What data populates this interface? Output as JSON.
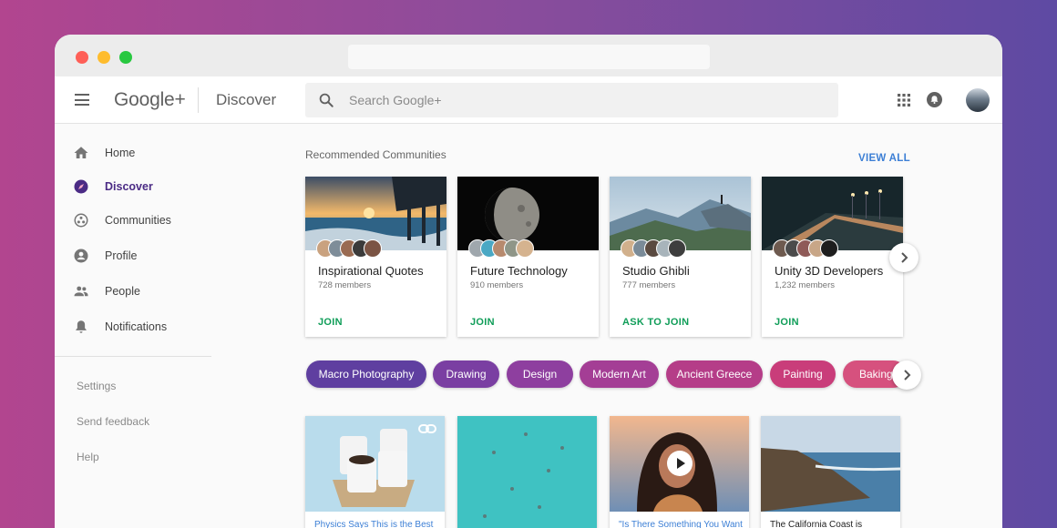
{
  "app": {
    "logo": "Google+",
    "section": "Discover"
  },
  "search": {
    "placeholder": "Search Google+",
    "value": ""
  },
  "sidebar": {
    "items": [
      {
        "label": "Home",
        "icon": "home-icon"
      },
      {
        "label": "Discover",
        "icon": "compass-icon",
        "active": true
      },
      {
        "label": "Communities",
        "icon": "communities-icon"
      },
      {
        "label": "Profile",
        "icon": "profile-icon"
      },
      {
        "label": "People",
        "icon": "people-icon"
      },
      {
        "label": "Notifications",
        "icon": "bell-icon"
      }
    ],
    "links": [
      "Settings",
      "Send feedback",
      "Help"
    ]
  },
  "recommended": {
    "title": "Recommended Communities",
    "view_all": "VIEW ALL",
    "cards": [
      {
        "name": "Inspirational Quotes",
        "members": "728 members",
        "action": "JOIN"
      },
      {
        "name": "Future Technology",
        "members": "910 members",
        "action": "JOIN"
      },
      {
        "name": "Studio Ghibli",
        "members": "777 members",
        "action": "ASK TO JOIN"
      },
      {
        "name": "Unity 3D Developers",
        "members": "1,232 members",
        "action": "JOIN"
      }
    ]
  },
  "chips": [
    {
      "label": "Macro Photography",
      "color": "#5f3fa0"
    },
    {
      "label": "Drawing",
      "color": "#7a3fa2"
    },
    {
      "label": "Design",
      "color": "#8e3f9f"
    },
    {
      "label": "Modern Art",
      "color": "#a43e95"
    },
    {
      "label": "Ancient Greece",
      "color": "#b53d88"
    },
    {
      "label": "Painting",
      "color": "#c93d7a"
    },
    {
      "label": "Baking",
      "color": "#d6517e"
    }
  ],
  "posts": [
    {
      "text": "Physics Says This is the Best"
    },
    {
      "text": ""
    },
    {
      "text": "\"Is There Something You Want"
    },
    {
      "text": "The California Coast is"
    }
  ],
  "colors": {
    "accent_blue": "#3c7fd5",
    "join_green": "#0f9d58",
    "active_purple": "#4b2b85"
  }
}
